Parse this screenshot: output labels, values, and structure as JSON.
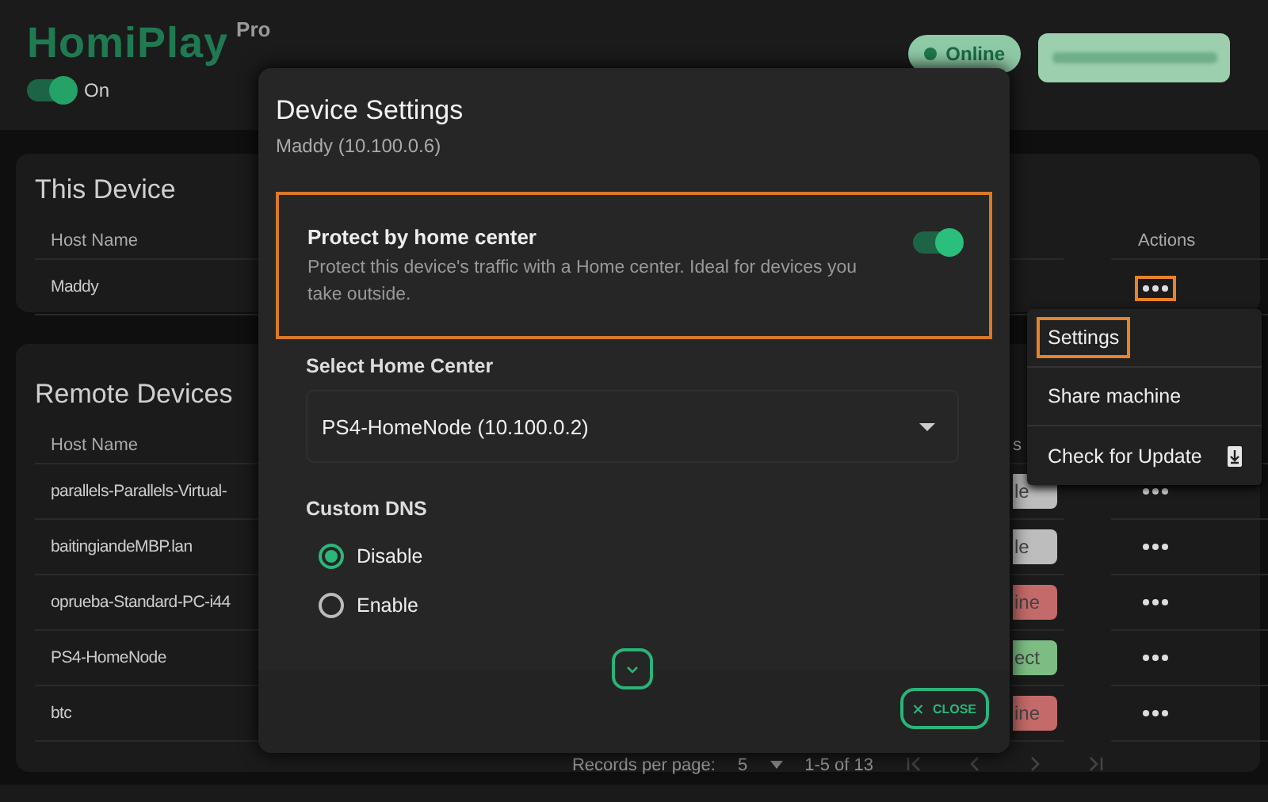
{
  "app": {
    "name": "HomiPlay",
    "edition": "Pro",
    "power": {
      "label": "On",
      "on": true
    }
  },
  "status_pill": {
    "label": "Online"
  },
  "this_device": {
    "title": "This Device",
    "columns": [
      "Host Name",
      "Actions"
    ],
    "rows": [
      {
        "host": "Maddy",
        "actions_highlighted": true
      }
    ]
  },
  "remote_devices": {
    "title": "Remote Devices",
    "columns": [
      "Host Name",
      "s"
    ],
    "rows": [
      {
        "host": "parallels-Parallels-Virtual-",
        "status": "le",
        "color": "#bdbdbd"
      },
      {
        "host": "baitingiandeMBP.lan",
        "status": "le",
        "color": "#bdbdbd"
      },
      {
        "host": "oprueba-Standard-PC-i44",
        "status": "ine",
        "color": "#c46a6a"
      },
      {
        "host": "PS4-HomeNode",
        "status": "ect",
        "color": "#7dbd84"
      },
      {
        "host": "btc",
        "status": "ine",
        "color": "#c46a6a"
      }
    ]
  },
  "pagination": {
    "label": "Records per page:",
    "per_page": "5",
    "range": "1-5 of 13"
  },
  "context_menu": [
    {
      "label": "Settings",
      "selected": true,
      "kind": "plain"
    },
    {
      "label": "Share machine",
      "selected": false,
      "kind": "plain"
    },
    {
      "label": "Check for Update",
      "selected": false,
      "kind": "download"
    }
  ],
  "dialog": {
    "title": "Device Settings",
    "subtitle": "Maddy (10.100.0.6)",
    "protect": {
      "title": "Protect by home center",
      "description": "Protect this device's traffic with a Home center. Ideal for devices you take outside.",
      "on": true,
      "highlighted": true
    },
    "home_center": {
      "label": "Select Home Center",
      "value": "PS4-HomeNode (10.100.0.2)"
    },
    "dns": {
      "label": "Custom DNS",
      "options": [
        {
          "label": "Disable",
          "selected": true
        },
        {
          "label": "Enable",
          "selected": false
        }
      ]
    },
    "close": "CLOSE"
  }
}
